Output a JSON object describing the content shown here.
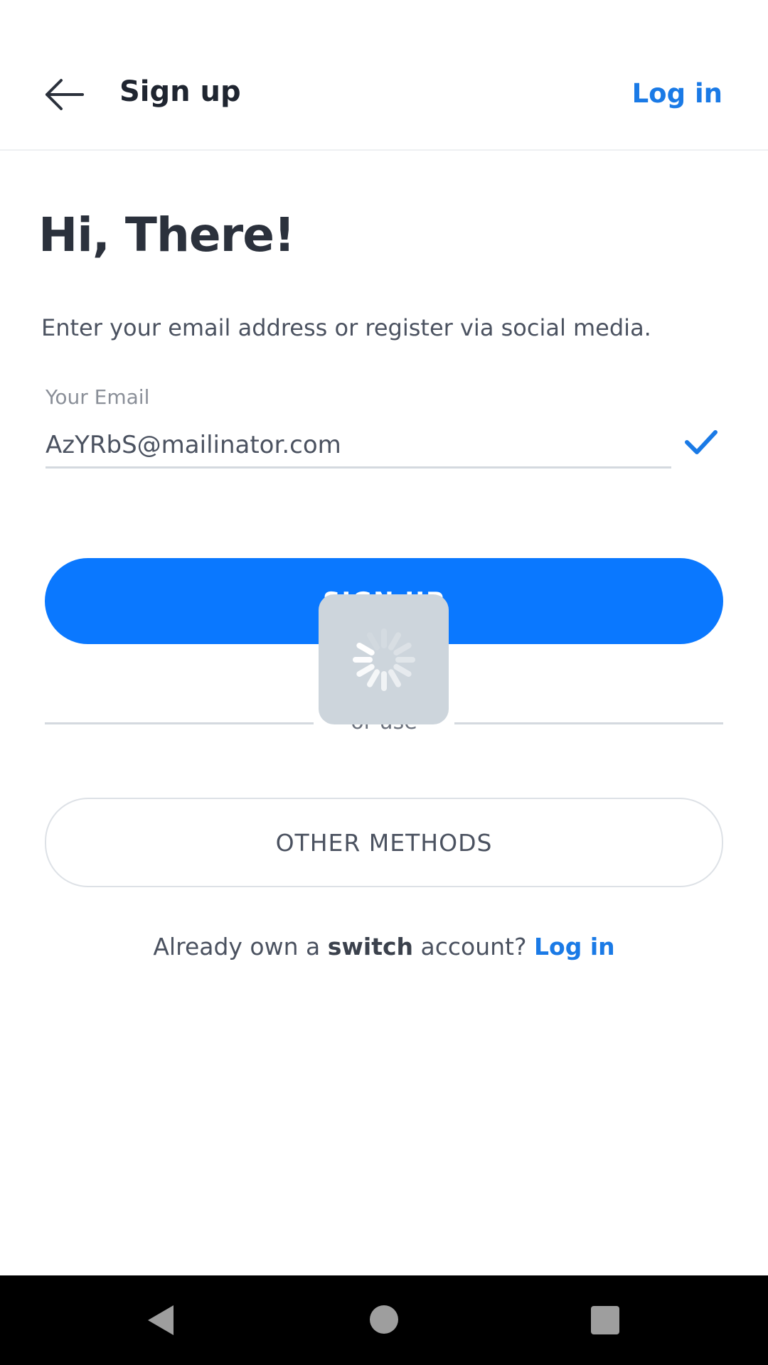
{
  "header": {
    "title": "Sign up",
    "login_link": "Log in"
  },
  "main": {
    "headline": "Hi, There!",
    "subtitle": "Enter your email address or register via social media.",
    "email": {
      "label": "Your Email",
      "value": "AzYRbS@mailinator.com",
      "valid": true
    },
    "signup_button": "SIGN UP",
    "divider_text": "or use",
    "other_methods_button": "OTHER METHODS",
    "footer": {
      "prefix": "Already own a",
      "brand": "switch",
      "suffix": "account?",
      "login_link": "Log in"
    }
  },
  "loading": true,
  "colors": {
    "accent": "#0a78ff",
    "link": "#1a7ae6",
    "text_dark": "#2b313c",
    "text_body": "#4b5260",
    "divider": "#d4d9df",
    "overlay": "#cdd5dc"
  },
  "icons": {
    "back": "arrow-left-icon",
    "check": "check-icon",
    "spinner": "spinner-icon"
  }
}
